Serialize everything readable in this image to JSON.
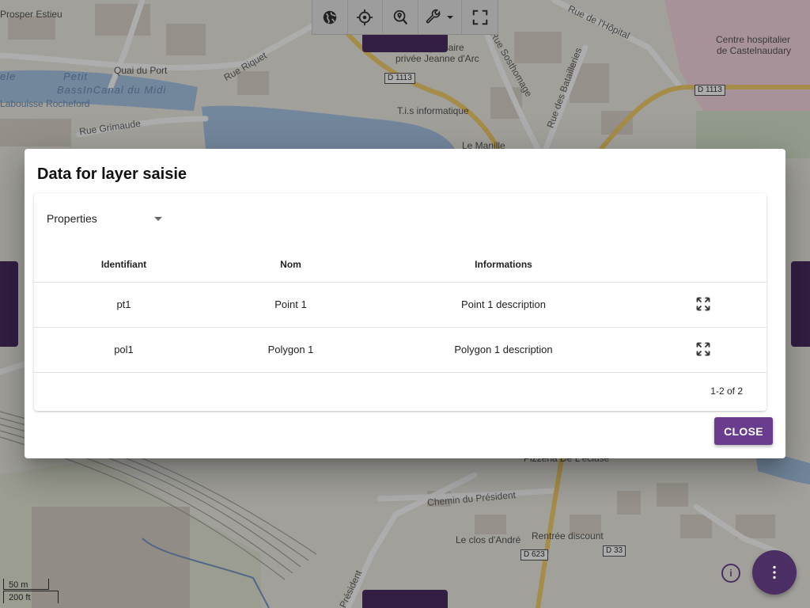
{
  "map": {
    "labels": {
      "prosper_estieu": "Prosper Estieu",
      "quai_du_port": "Quai du Port",
      "rue_riquet": "Rue Riquet",
      "petit": "Petit",
      "bassin_canal": "BassInCanal du Midi",
      "labouisse": "Labouisse Rocheford",
      "rue_grimaude": "Rue Grimaude",
      "ecole": "Ecole primaire",
      "privee": "privée Jeanne d'Arc",
      "rue_sosthomage": "Rue Sosthomage",
      "rue_batailleries": "Rue des Batailleries",
      "rue_hopital": "Rue de l'Hôpital",
      "centre_hosp_1": "Centre hospitalier",
      "centre_hosp_2": "de Castelnaudary",
      "tis": "T.i.s informatique",
      "le_manille": "Le Manille",
      "pizzeria": "Pizzeria De L'écluse",
      "chemin_president": "Chemin du Président",
      "clos_andre": "Le clos d'André",
      "rentree": "Rentrée discount",
      "president": "Président",
      "ele": "ele"
    },
    "shields": {
      "d1113_a": "D 1113",
      "d1113_b": "D 1113",
      "d623": "D 623",
      "d33": "D 33"
    },
    "scale": {
      "metric": "50 m",
      "imperial": "200 ft"
    }
  },
  "toolbar": {
    "icons": [
      "globe-icon",
      "crosshair-icon",
      "zoom-location-icon",
      "wrench-icon",
      "fullscreen-icon"
    ]
  },
  "dialog": {
    "title": "Data for layer saisie",
    "select_value": "Properties",
    "table": {
      "headers": [
        "Identifiant",
        "Nom",
        "Informations",
        ""
      ],
      "rows": [
        {
          "id": "pt1",
          "nom": "Point 1",
          "info": "Point 1 description"
        },
        {
          "id": "pol1",
          "nom": "Polygon 1",
          "info": "Polygon 1 description"
        }
      ]
    },
    "pagination": "1-2 of 2",
    "close_label": "CLOSE"
  },
  "fab": {
    "info_label": "i"
  },
  "colors": {
    "primary": "#6a3c8e",
    "primary_dark": "#4b2e63",
    "water": "#a9c6e6",
    "road_yellow": "#f4cf6a"
  }
}
